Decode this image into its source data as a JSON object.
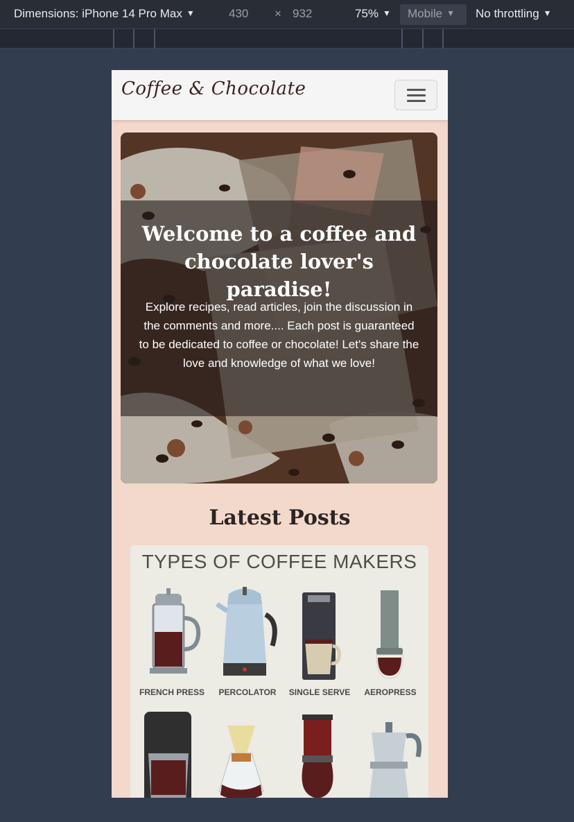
{
  "devtools": {
    "dimensions_label": "Dimensions: iPhone 14 Pro Max",
    "width": "430",
    "height": "932",
    "times": "×",
    "zoom": "75%",
    "mode": "Mobile",
    "throttling": "No throttling",
    "caret": "▼"
  },
  "site": {
    "brand": "Coffee & Chocolate",
    "hero": {
      "title": "Welcome to a coffee and chocolate lover's paradise!",
      "text": "Explore recipes, read articles, join the discussion in the comments and more.... Each post is guaranteed to be dedicated to coffee or chocolate! Let's share the love and knowledge of what we love!"
    },
    "latest_posts_title": "Latest Posts",
    "post": {
      "image_title": "TYPES OF COFFEE MAKERS",
      "labels": [
        "FRENCH PRESS",
        "PERCOLATOR",
        "SINGLE SERVE",
        "AEROPRESS"
      ]
    }
  },
  "colors": {
    "page_bg": "#f3d8cc",
    "brand_text": "#3b2320",
    "desktop_bg": "#333d50"
  }
}
